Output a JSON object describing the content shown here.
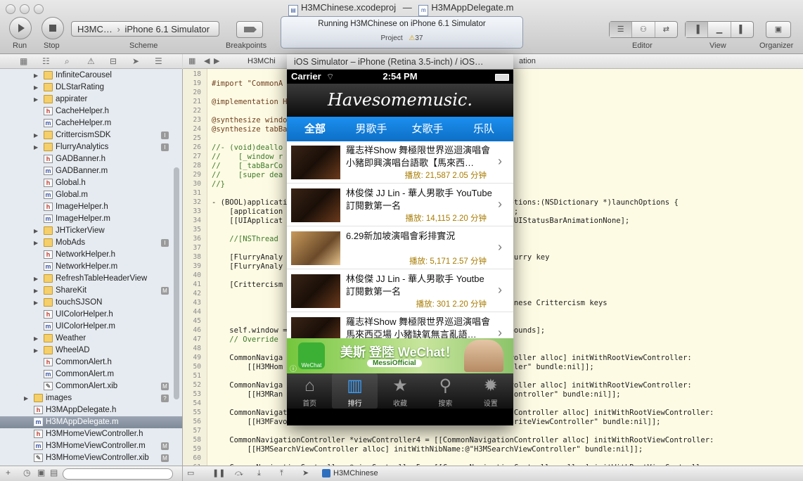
{
  "window": {
    "project_file": "H3MChinese.xcodeproj",
    "separator": "—",
    "active_file": "H3MAppDelegate.m"
  },
  "toolbar": {
    "run_label": "Run",
    "stop_label": "Stop",
    "scheme_label": "Scheme",
    "scheme_target": "H3MC…",
    "scheme_destination": "iPhone 6.1 Simulator",
    "breakpoints_label": "Breakpoints",
    "status_text": "Running H3MChinese on iPhone 6.1 Simulator",
    "status_project": "Project",
    "warning_count": "37",
    "editor_label": "Editor",
    "view_label": "View",
    "organizer_label": "Organizer"
  },
  "navigator": {
    "items": [
      {
        "type": "folder",
        "name": "InfiniteCarousel",
        "badge": ""
      },
      {
        "type": "folder",
        "name": "DLStarRating",
        "badge": ""
      },
      {
        "type": "folder",
        "name": "appirater",
        "badge": ""
      },
      {
        "type": "h",
        "name": "CacheHelper.h",
        "badge": ""
      },
      {
        "type": "m",
        "name": "CacheHelper.m",
        "badge": ""
      },
      {
        "type": "folder",
        "name": "CrittercismSDK",
        "badge": "I"
      },
      {
        "type": "folder",
        "name": "FlurryAnalytics",
        "badge": "I"
      },
      {
        "type": "h",
        "name": "GADBanner.h",
        "badge": ""
      },
      {
        "type": "m",
        "name": "GADBanner.m",
        "badge": ""
      },
      {
        "type": "h",
        "name": "Global.h",
        "badge": ""
      },
      {
        "type": "m",
        "name": "Global.m",
        "badge": ""
      },
      {
        "type": "h",
        "name": "ImageHelper.h",
        "badge": ""
      },
      {
        "type": "m",
        "name": "ImageHelper.m",
        "badge": ""
      },
      {
        "type": "folder",
        "name": "JHTickerView",
        "badge": ""
      },
      {
        "type": "folder",
        "name": "MobAds",
        "badge": "I"
      },
      {
        "type": "h",
        "name": "NetworkHelper.h",
        "badge": ""
      },
      {
        "type": "m",
        "name": "NetworkHelper.m",
        "badge": ""
      },
      {
        "type": "folder",
        "name": "RefreshTableHeaderView",
        "badge": ""
      },
      {
        "type": "folder",
        "name": "ShareKit",
        "badge": "M"
      },
      {
        "type": "folder",
        "name": "touchSJSON",
        "badge": ""
      },
      {
        "type": "h",
        "name": "UIColorHelper.h",
        "badge": ""
      },
      {
        "type": "m",
        "name": "UIColorHelper.m",
        "badge": ""
      },
      {
        "type": "folder",
        "name": "Weather",
        "badge": ""
      },
      {
        "type": "folder",
        "name": "WheelAD",
        "badge": ""
      },
      {
        "type": "h",
        "name": "CommonAlert.h",
        "badge": ""
      },
      {
        "type": "m",
        "name": "CommonAlert.m",
        "badge": ""
      },
      {
        "type": "x",
        "name": "CommonAlert.xib",
        "badge": "M"
      },
      {
        "type": "folder",
        "name": "images",
        "badge": "?"
      },
      {
        "type": "h",
        "name": "H3MAppDelegate.h",
        "badge": ""
      },
      {
        "type": "m",
        "name": "H3MAppDelegate.m",
        "badge": ""
      },
      {
        "type": "h",
        "name": "H3MHomeViewController.h",
        "badge": ""
      },
      {
        "type": "m",
        "name": "H3MHomeViewController.m",
        "badge": "M"
      },
      {
        "type": "x",
        "name": "H3MHomeViewController.xib",
        "badge": "M"
      }
    ]
  },
  "editor": {
    "jump_file": "H3MChi",
    "jump_tail": "ation",
    "lines": [
      {
        "n": "18",
        "t": ""
      },
      {
        "n": "19",
        "t": "#import \"CommonA"
      },
      {
        "n": "20",
        "t": ""
      },
      {
        "n": "21",
        "t": "@implementation H"
      },
      {
        "n": "22",
        "t": ""
      },
      {
        "n": "23",
        "t": "@synthesize windo"
      },
      {
        "n": "24",
        "t": "@synthesize tabBa"
      },
      {
        "n": "25",
        "t": ""
      },
      {
        "n": "26",
        "t": "//- (void)deallo"
      },
      {
        "n": "27",
        "t": "//    [_window r"
      },
      {
        "n": "28",
        "t": "//    [_tabBarCo"
      },
      {
        "n": "29",
        "t": "//    [super dea"
      },
      {
        "n": "30",
        "t": "//}"
      },
      {
        "n": "31",
        "t": ""
      },
      {
        "n": "32",
        "t": "- (BOOL)applicati                                          ingWithOptions:(NSDictionary *)launchOptions {"
      },
      {
        "n": "33",
        "t": "    [application                                          imated:NO];"
      },
      {
        "n": "34",
        "t": "    [[UIApplicat                                          Animation:UIStatusBarAnimationNone];"
      },
      {
        "n": "35",
        "t": ""
      },
      {
        "n": "36",
        "t": "    //[NSThread"
      },
      {
        "n": "37",
        "t": ""
      },
      {
        "n": "38",
        "t": "    [FlurryAnaly                                          Chinese Flurry key"
      },
      {
        "n": "39",
        "t": "    [FlurryAnaly"
      },
      {
        "n": "40",
        "t": ""
      },
      {
        "n": "41",
        "t": "    [Crittercism"
      },
      {
        "n": "42",
        "t": ""
      },
      {
        "n": "43",
        "t": "                                                        \"]; //H3MChinese Crittercism keys"
      },
      {
        "n": "44",
        "t": ""
      },
      {
        "n": "45",
        "t": ""
      },
      {
        "n": "46",
        "t": "    self.window =                                          Screen] bounds];"
      },
      {
        "n": "47",
        "t": "    // Override"
      },
      {
        "n": "48",
        "t": ""
      },
      {
        "n": "49",
        "t": "    CommonNaviga                                          ationController alloc] initWithRootViewController:"
      },
      {
        "n": "50",
        "t": "        [[H3MHom                                          iewController\" bundle:nil]];"
      },
      {
        "n": "51",
        "t": ""
      },
      {
        "n": "52",
        "t": "    CommonNaviga                                          ationController alloc] initWithRootViewController:"
      },
      {
        "n": "53",
        "t": "        [[H3MRan                                          nkingViewController\" bundle:nil]];"
      },
      {
        "n": "54",
        "t": ""
      },
      {
        "n": "55",
        "t": "    CommonNavigationController *viewController3 = [[CommonNavigationController alloc] initWithRootViewController:"
      },
      {
        "n": "56",
        "t": "        [[H3MFavoriteViewController alloc] initWithNibName:@\"H3MFavoriteViewController\" bundle:nil]];"
      },
      {
        "n": "57",
        "t": ""
      },
      {
        "n": "58",
        "t": "    CommonNavigationController *viewController4 = [[CommonNavigationController alloc] initWithRootViewController:"
      },
      {
        "n": "59",
        "t": "        [[H3MSearchViewController alloc] initWithNibName:@\"H3MSearchViewController\" bundle:nil]];"
      },
      {
        "n": "60",
        "t": ""
      },
      {
        "n": "61",
        "t": "    CommonNavigationController *viewController5 = [[CommonNavigationController alloc] initWithRootViewController:"
      }
    ]
  },
  "debug": {
    "target": "H3MChinese"
  },
  "simulator": {
    "title": "iOS Simulator – iPhone (Retina 3.5-inch) / iOS…",
    "carrier": "Carrier",
    "time": "2:54 PM",
    "app_title": "Havesomemusic.",
    "categories": [
      "全部",
      "男歌手",
      "女歌手",
      "乐队"
    ],
    "videos": [
      {
        "title": "羅志祥Show 舞極限世界巡迴演唱會 小豬即興演唱台語歌【馬來西…",
        "meta": "播放: 21,587   2.05 分钟"
      },
      {
        "title": "林俊傑 JJ Lin - 華人男歌手 YouTube 訂閱數第一名",
        "meta": "播放: 14,115   2.20 分钟"
      },
      {
        "title": "6.29新加坡演唱會彩排實況",
        "meta": "播放: 5,171   2.57 分钟"
      },
      {
        "title": "林俊傑 JJ Lin - 華人男歌手 Youtbe 訂閱數第一名",
        "meta": "播放: 301   2.20 分钟"
      },
      {
        "title": "羅志祥Show 舞極限世界巡迴演唱會馬來西亞場 小豬缺氧無言亂語…",
        "meta": ""
      }
    ],
    "ad_headline": "美斯 登陸 WeChat！",
    "ad_sub": "MessiOfficial",
    "ad_logo_text": "WeChat",
    "tabs": [
      {
        "label": "首页",
        "icon": "home-icon",
        "active": false
      },
      {
        "label": "排行",
        "icon": "ranking-icon",
        "active": true
      },
      {
        "label": "收藏",
        "icon": "star-icon",
        "active": false
      },
      {
        "label": "搜索",
        "icon": "search-icon",
        "active": false
      },
      {
        "label": "设置",
        "icon": "gear-icon",
        "active": false
      }
    ]
  }
}
